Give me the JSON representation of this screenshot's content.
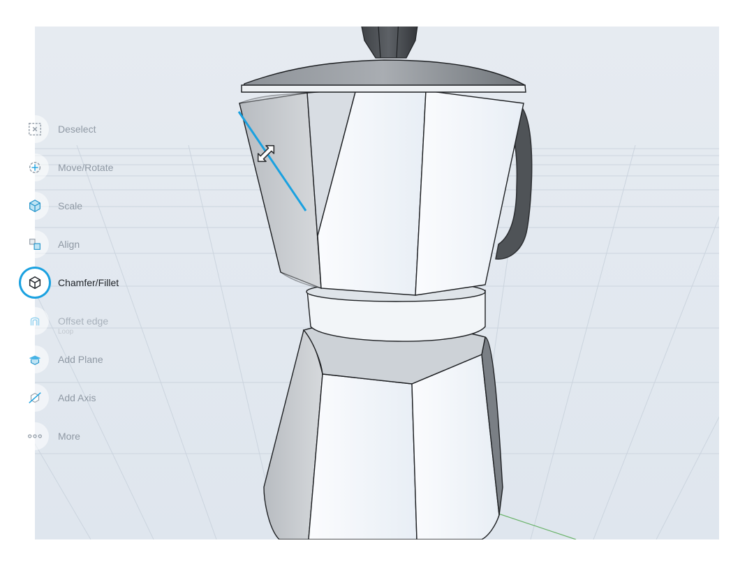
{
  "toolbar": {
    "items": [
      {
        "label": "Deselect",
        "icon": "deselect-icon"
      },
      {
        "label": "Move/Rotate",
        "icon": "move-rotate-icon"
      },
      {
        "label": "Scale",
        "icon": "scale-cube-icon"
      },
      {
        "label": "Align",
        "icon": "align-icon"
      },
      {
        "label": "Chamfer/Fillet",
        "icon": "chamfer-fillet-icon",
        "active": true
      },
      {
        "label": "Offset edge",
        "sublabel": "Loop",
        "icon": "offset-edge-icon"
      },
      {
        "label": "Add Plane",
        "icon": "add-plane-icon"
      },
      {
        "label": "Add Axis",
        "icon": "add-axis-icon"
      },
      {
        "label": "More",
        "icon": "more-icon"
      }
    ]
  },
  "colors": {
    "accent": "#1aa1e0",
    "viewport_bg": "#e9eef4",
    "grid": "#c9d3dd",
    "model_dark": "#4f5357",
    "model_light": "#f4f7fa"
  }
}
